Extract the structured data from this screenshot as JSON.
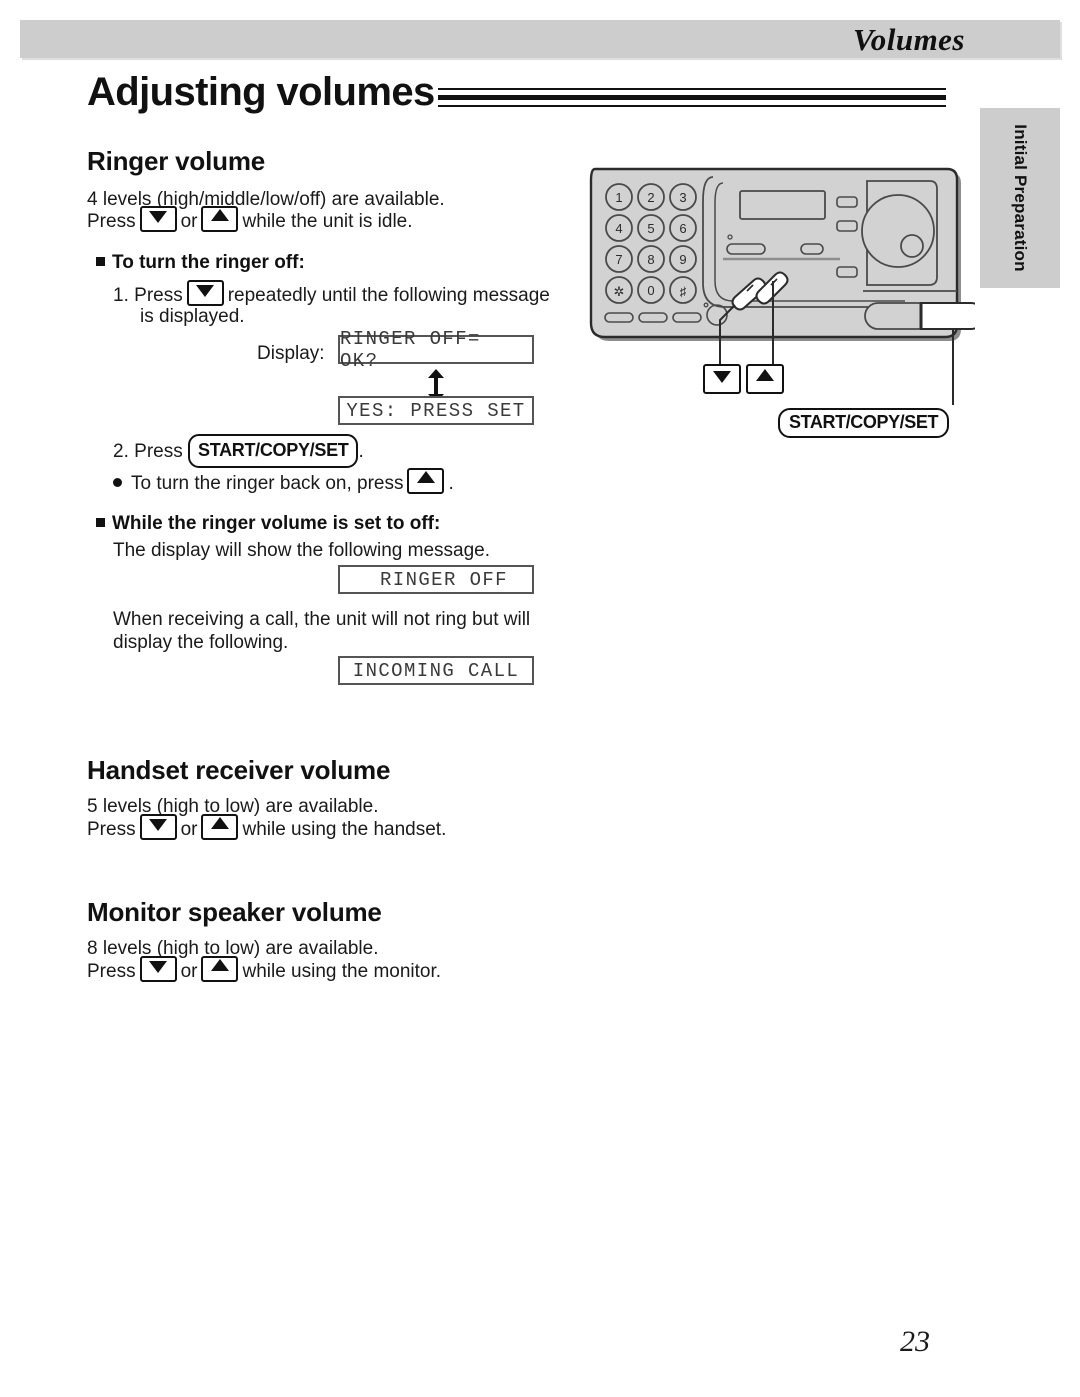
{
  "header": {
    "title": "Volumes",
    "band_color": "#cdcdcd"
  },
  "page_heading": "Adjusting volumes",
  "side_tab": {
    "label": "Initial Preparation",
    "color": "#cdcdcd"
  },
  "sections": [
    {
      "title": "Ringer volume",
      "intro_line_1": "4 levels (high/middle/low/off) are available.",
      "intro_press": "Press",
      "intro_or": "or",
      "intro_tail": "while the unit is idle.",
      "sub_a": {
        "heading": "To turn the ringer off:",
        "step1_number": "1.",
        "step1_press": "Press",
        "step1_tail": "repeatedly until the following message",
        "step1_tail2": "is displayed.",
        "display_label": "Display:",
        "lcd_1": "RINGER OFF= OK?",
        "lcd_2": "YES: PRESS SET",
        "step2_number": "2.",
        "step2_press": "Press",
        "step2_button": "START/COPY/SET",
        "step2_period": ".",
        "note_text": "To turn the ringer back on, press",
        "note_period": "."
      },
      "sub_b": {
        "heading": "While the ringer volume is set to off:",
        "line_1": "The display will show the following message.",
        "lcd_3": "RINGER OFF",
        "line_2": "When receiving a call, the unit will not ring but will",
        "line_3": "display the following.",
        "lcd_4": "INCOMING CALL"
      }
    },
    {
      "title": "Handset receiver volume",
      "intro_line_1": "5 levels (high to low) are available.",
      "intro_press": "Press",
      "intro_or": "or",
      "intro_tail": "while using the handset."
    },
    {
      "title": "Monitor speaker volume",
      "intro_line_1": "8 levels (high to low) are available.",
      "intro_press": "Press",
      "intro_or": "or",
      "intro_tail": "while using the monitor."
    }
  ],
  "illustration": {
    "keypad": [
      "1",
      "2",
      "3",
      "4",
      "5",
      "6",
      "7",
      "8",
      "9",
      "*",
      "#",
      "0"
    ],
    "callouts": {
      "down_key": "down-arrow-key",
      "up_key": "up-arrow-key",
      "start_copy_set": "START/COPY/SET"
    }
  },
  "page_number": "23"
}
